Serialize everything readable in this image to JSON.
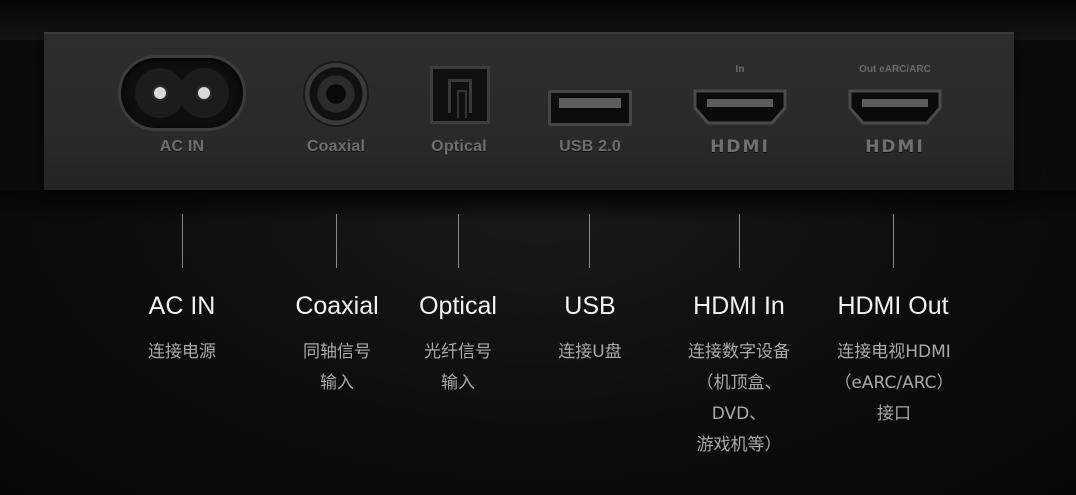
{
  "panel": {
    "ports": [
      {
        "id": "ac",
        "label": "AC IN"
      },
      {
        "id": "coax",
        "label": "Coaxial"
      },
      {
        "id": "optical",
        "label": "Optical"
      },
      {
        "id": "usb",
        "label": "USB 2.0"
      },
      {
        "id": "hdmi_in",
        "label": "HDMI",
        "caption": "In"
      },
      {
        "id": "hdmi_out",
        "label": "HDMI",
        "caption": "Out eARC/ARC"
      }
    ]
  },
  "legend": [
    {
      "title": "AC IN",
      "lines": [
        "连接电源"
      ]
    },
    {
      "title": "Coaxial",
      "lines": [
        "同轴信号",
        "输入"
      ]
    },
    {
      "title": "Optical",
      "lines": [
        "光纤信号",
        "输入"
      ]
    },
    {
      "title": "USB",
      "lines": [
        "连接U盘"
      ]
    },
    {
      "title": "HDMI In",
      "lines": [
        "连接数字设备",
        "（机顶盒、",
        "DVD、",
        "游戏机等）"
      ]
    },
    {
      "title": "HDMI Out",
      "lines": [
        "连接电视HDMI",
        "（eARC/ARC）",
        "接口"
      ]
    }
  ]
}
